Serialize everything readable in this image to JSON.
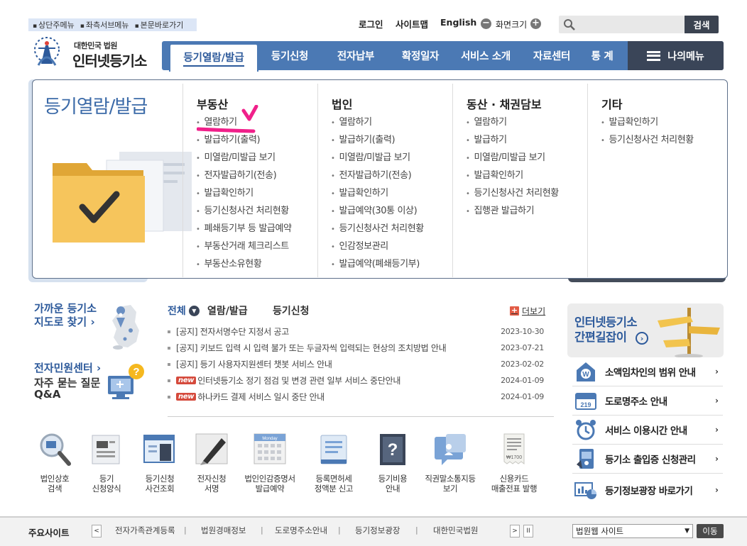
{
  "skipnav": [
    "상단주메뉴",
    "좌측서브메뉴",
    "본문바로가기"
  ],
  "logo": {
    "sub": "대한민국 법원",
    "main": "인터넷등기소"
  },
  "util": {
    "login": "로그인",
    "sitemap": "사이트맵",
    "english": "English",
    "zoom": "화면크기",
    "minus": "−",
    "plus": "+"
  },
  "search": {
    "placeholder": "",
    "button": "검색"
  },
  "nav": {
    "active": "등기열람/발급",
    "items": [
      "등기신청",
      "전자납부",
      "확정일자",
      "서비스 소개",
      "자료센터",
      "통 계"
    ],
    "mymenu": "나의메뉴"
  },
  "dropdown": {
    "title": "등기열람/발급",
    "columns": [
      {
        "head": "부동산",
        "items": [
          "열람하기",
          "발급하기(출력)",
          "미열람/미발급 보기",
          "전자발급하기(전송)",
          "발급확인하기",
          "등기신청사건 처리현황",
          "폐쇄등기부 등 발급예약",
          "부동산거래 체크리스트",
          "부동산소유현황"
        ]
      },
      {
        "head": "법인",
        "items": [
          "열람하기",
          "발급하기(출력)",
          "미열람/미발급 보기",
          "전자발급하기(전송)",
          "발급확인하기",
          "발급예약(30통 이상)",
          "등기신청사건 처리현황",
          "인감정보관리",
          "발급예약(폐쇄등기부)"
        ]
      },
      {
        "head": "동산 · 채권담보",
        "items": [
          "열람하기",
          "발급하기",
          "미열람/미발급 보기",
          "발급확인하기",
          "등기신청사건 처리현황",
          "집행관 발급하기"
        ]
      },
      {
        "head": "기타",
        "items": [
          "발급확인하기",
          "등기신청사건 처리현황"
        ]
      }
    ]
  },
  "left": {
    "map_line1": "가까운 등기소",
    "map_line2": "지도로 찾기",
    "center": "전자민원센터",
    "qa_line1": "자주 묻는 질문",
    "qa_line2": "Q&A",
    "chev": "›"
  },
  "notice": {
    "tabs": [
      "전체",
      "열람/발급",
      "등기신청"
    ],
    "more": "더보기",
    "new_label": "new",
    "items": [
      {
        "new": false,
        "text": "[공지] 전자서명수단 지정서 공고",
        "date": "2023-10-30"
      },
      {
        "new": false,
        "text": "[공지] 키보드 입력 시 입력 불가 또는 두글자씩 입력되는 현상의 조치방법 안내",
        "date": "2023-07-21"
      },
      {
        "new": false,
        "text": "[공지] 등기 사용자지원센터 챗봇 서비스 안내",
        "date": "2023-02-02"
      },
      {
        "new": true,
        "text": "인터넷등기소 정기 점검 및 변경 관련 일부 서비스 중단안내",
        "date": "2024-01-09"
      },
      {
        "new": true,
        "text": "하나카드 결제 서비스 일시 중단 안내",
        "date": "2024-01-09"
      }
    ]
  },
  "quick": [
    {
      "line1": "법인상호",
      "line2": "검색",
      "icon": "magnifier-icon"
    },
    {
      "line1": "등기",
      "line2": "신청양식",
      "icon": "form-icon"
    },
    {
      "line1": "등기신청",
      "line2": "사건조회",
      "icon": "case-icon"
    },
    {
      "line1": "전자신청",
      "line2": "서명",
      "icon": "pen-icon"
    },
    {
      "line1": "법인인감증명서",
      "line2": "발급예약",
      "icon": "calendar-icon"
    },
    {
      "line1": "등록면허세",
      "line2": "정액분 신고",
      "icon": "document-icon"
    },
    {
      "line1": "등기비용",
      "line2": "안내",
      "icon": "question-book-icon"
    },
    {
      "line1": "직권말소통지등",
      "line2": "보기",
      "icon": "notice-icon"
    },
    {
      "line1": "신용카드",
      "line2": "매출전표 발행",
      "icon": "receipt-icon"
    }
  ],
  "quick_receipt_amount": "₩1700",
  "quick_calendar_label": "Monday",
  "guide": {
    "line1": "인터넷등기소",
    "line2": "간편길잡이"
  },
  "side": [
    {
      "label": "소액임차인의 범위 안내",
      "icon": "house-won-icon"
    },
    {
      "label": "도로명주소 안내",
      "icon": "road-sign-icon",
      "sign": "219"
    },
    {
      "label": "서비스 이용시간 안내",
      "icon": "alarm-clock-icon"
    },
    {
      "label": "등기소 출입증 신청관리",
      "icon": "access-card-icon"
    },
    {
      "label": "등기정보광장 바로가기",
      "icon": "chart-monitor-icon"
    }
  ],
  "footer": {
    "label": "주요사이트",
    "prev": "<",
    "next": ">",
    "pause": "II",
    "links": [
      "전자가족관계등록",
      "법원경매정보",
      "도로명주소안내",
      "등기정보광장",
      "대한민국법원"
    ],
    "select_value": "법원웹 사이트",
    "go": "이동"
  },
  "colors": {
    "primary": "#4b79b4",
    "dark": "#3a4558",
    "accent_red": "#d54a3c",
    "pink_mark": "#f0208a"
  }
}
